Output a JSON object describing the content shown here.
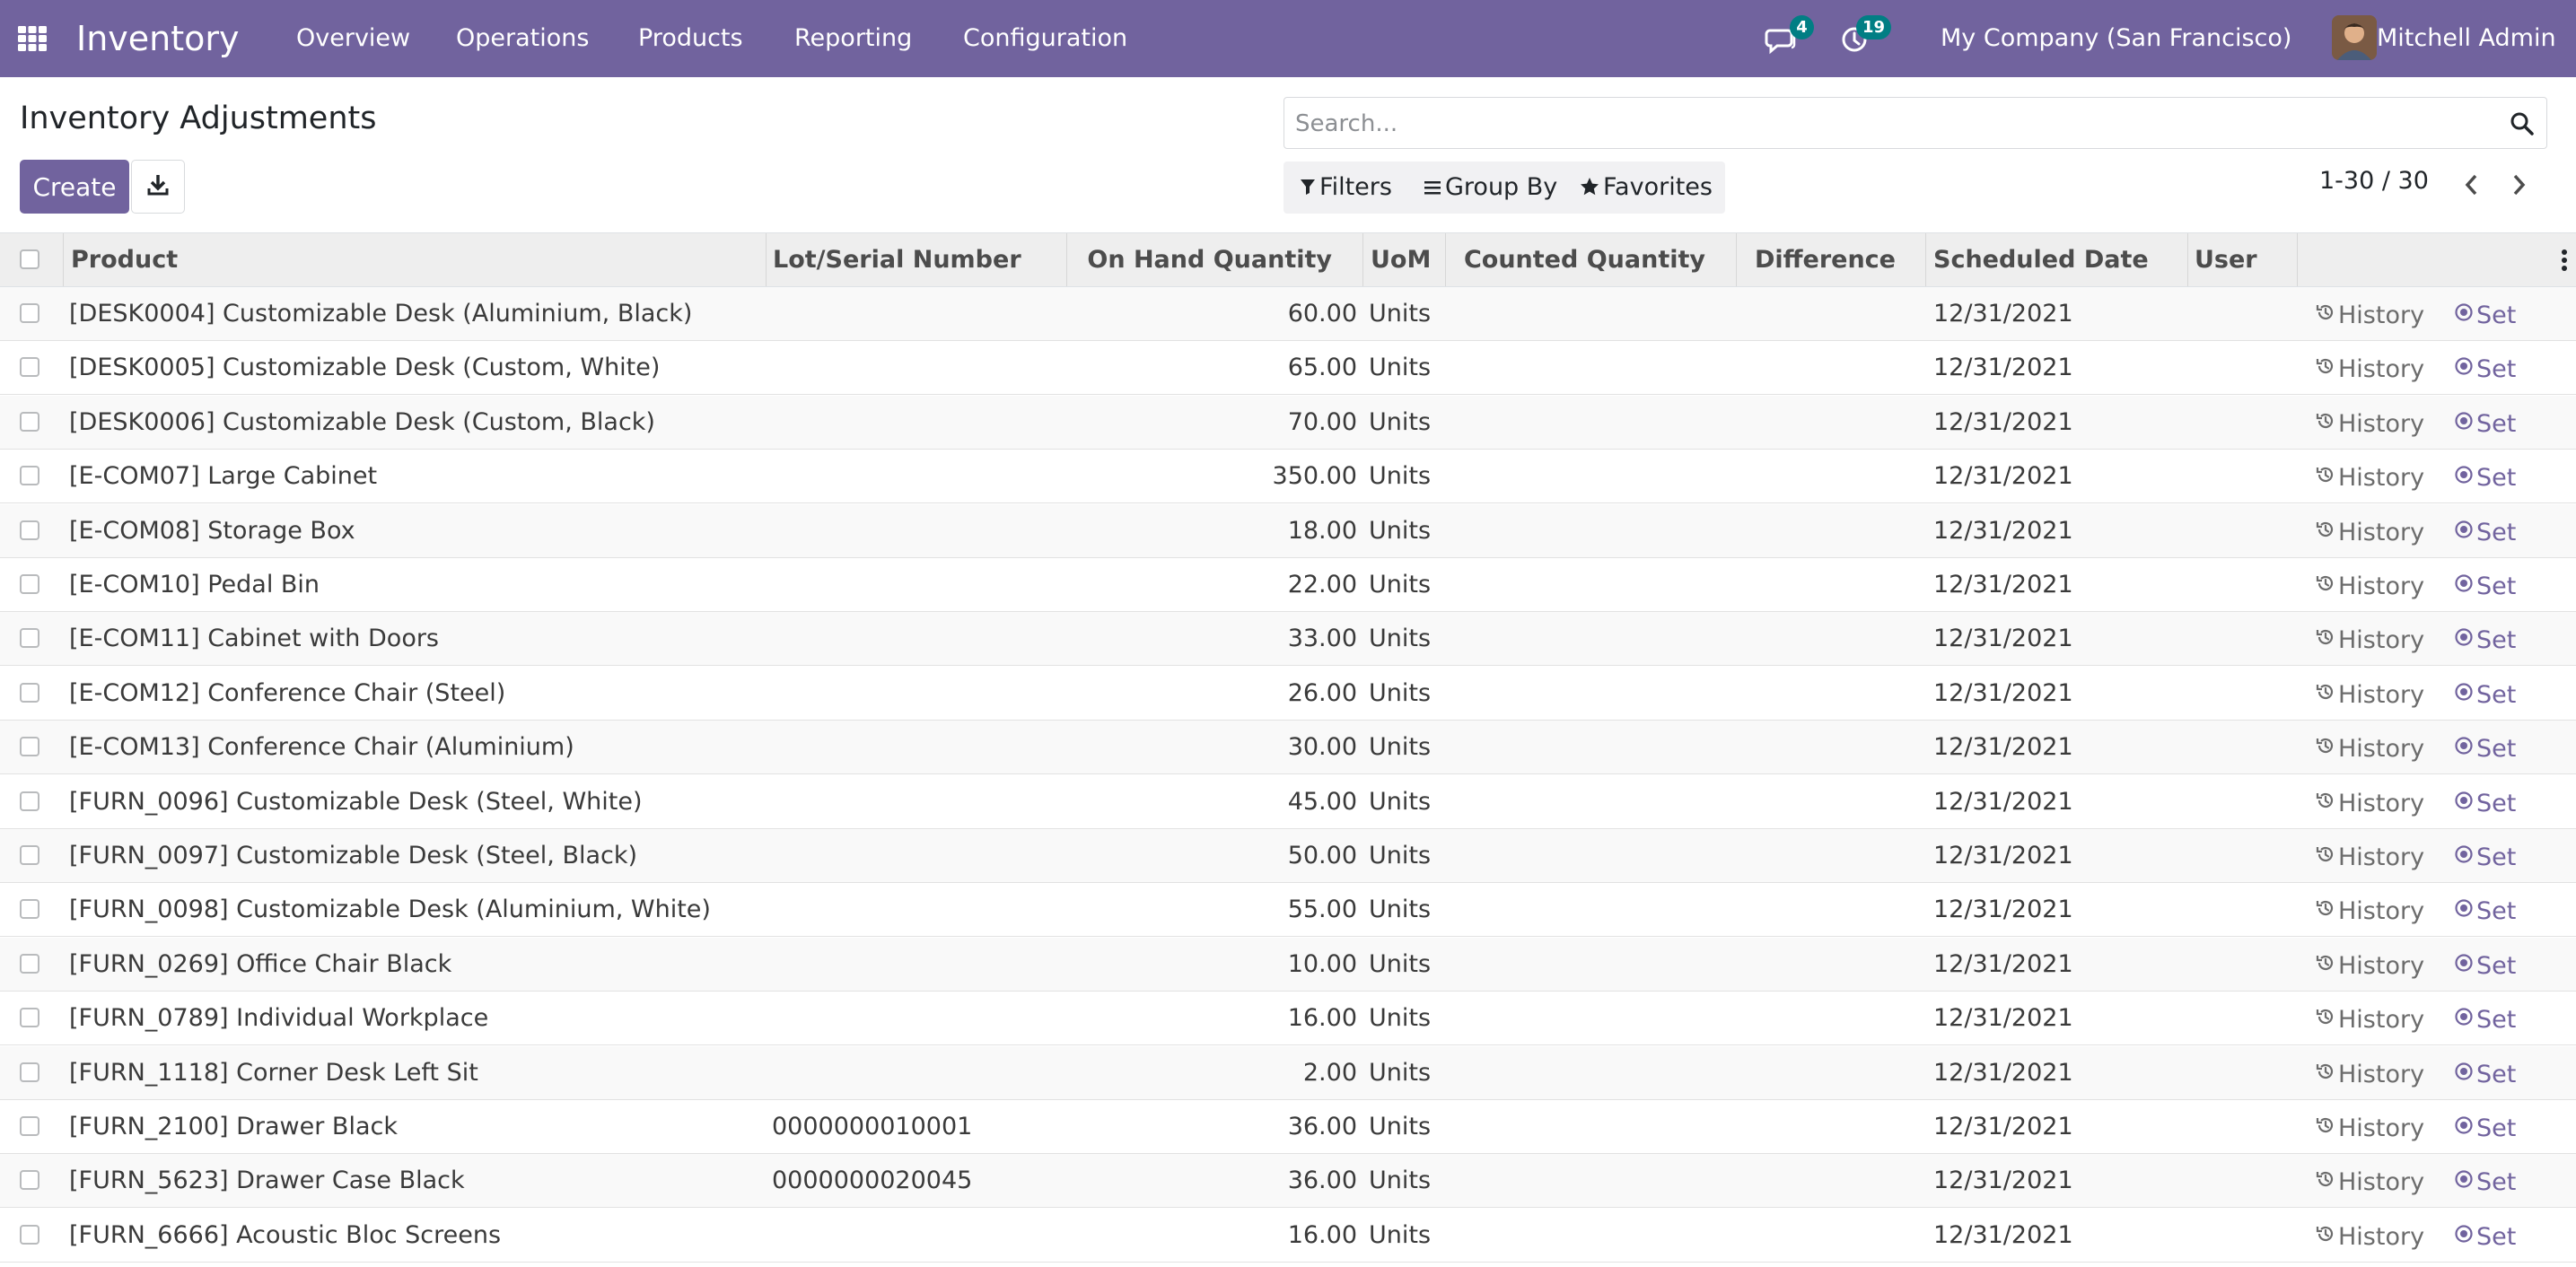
{
  "navbar": {
    "brand": "Inventory",
    "menu": [
      "Overview",
      "Operations",
      "Products",
      "Reporting",
      "Configuration"
    ],
    "messages_count": "4",
    "activities_count": "19",
    "company": "My Company (San Francisco)",
    "user": "Mitchell Admin",
    "icons": [
      "apps-grid-icon",
      "chat-icon",
      "clock-icon"
    ],
    "accent_color": "#71639e",
    "badge_color": "#017e84"
  },
  "control_panel": {
    "title": "Inventory Adjustments",
    "create_label": "Create",
    "search_placeholder": "Search...",
    "filters_label": "Filters",
    "group_by_label": "Group By",
    "favorites_label": "Favorites",
    "pager": "1-30 / 30"
  },
  "table": {
    "headers": {
      "product": "Product",
      "lot": "Lot/Serial Number",
      "on_hand": "On Hand Quantity",
      "uom": "UoM",
      "counted": "Counted Quantity",
      "difference": "Difference",
      "scheduled": "Scheduled Date",
      "user": "User"
    },
    "history_label": "History",
    "set_label": "Set",
    "rows": [
      {
        "product": "[DESK0004] Customizable Desk (Aluminium, Black)",
        "lot": "",
        "qty": "60.00",
        "uom": "Units",
        "date": "12/31/2021"
      },
      {
        "product": "[DESK0005] Customizable Desk (Custom, White)",
        "lot": "",
        "qty": "65.00",
        "uom": "Units",
        "date": "12/31/2021"
      },
      {
        "product": "[DESK0006] Customizable Desk (Custom, Black)",
        "lot": "",
        "qty": "70.00",
        "uom": "Units",
        "date": "12/31/2021"
      },
      {
        "product": "[E-COM07] Large Cabinet",
        "lot": "",
        "qty": "350.00",
        "uom": "Units",
        "date": "12/31/2021"
      },
      {
        "product": "[E-COM08] Storage Box",
        "lot": "",
        "qty": "18.00",
        "uom": "Units",
        "date": "12/31/2021"
      },
      {
        "product": "[E-COM10] Pedal Bin",
        "lot": "",
        "qty": "22.00",
        "uom": "Units",
        "date": "12/31/2021"
      },
      {
        "product": "[E-COM11] Cabinet with Doors",
        "lot": "",
        "qty": "33.00",
        "uom": "Units",
        "date": "12/31/2021"
      },
      {
        "product": "[E-COM12] Conference Chair (Steel)",
        "lot": "",
        "qty": "26.00",
        "uom": "Units",
        "date": "12/31/2021"
      },
      {
        "product": "[E-COM13] Conference Chair (Aluminium)",
        "lot": "",
        "qty": "30.00",
        "uom": "Units",
        "date": "12/31/2021"
      },
      {
        "product": "[FURN_0096] Customizable Desk (Steel, White)",
        "lot": "",
        "qty": "45.00",
        "uom": "Units",
        "date": "12/31/2021"
      },
      {
        "product": "[FURN_0097] Customizable Desk (Steel, Black)",
        "lot": "",
        "qty": "50.00",
        "uom": "Units",
        "date": "12/31/2021"
      },
      {
        "product": "[FURN_0098] Customizable Desk (Aluminium, White)",
        "lot": "",
        "qty": "55.00",
        "uom": "Units",
        "date": "12/31/2021"
      },
      {
        "product": "[FURN_0269] Office Chair Black",
        "lot": "",
        "qty": "10.00",
        "uom": "Units",
        "date": "12/31/2021"
      },
      {
        "product": "[FURN_0789] Individual Workplace",
        "lot": "",
        "qty": "16.00",
        "uom": "Units",
        "date": "12/31/2021"
      },
      {
        "product": "[FURN_1118] Corner Desk Left Sit",
        "lot": "",
        "qty": "2.00",
        "uom": "Units",
        "date": "12/31/2021"
      },
      {
        "product": "[FURN_2100] Drawer Black",
        "lot": "0000000010001",
        "qty": "36.00",
        "uom": "Units",
        "date": "12/31/2021"
      },
      {
        "product": "[FURN_5623] Drawer Case Black",
        "lot": "0000000020045",
        "qty": "36.00",
        "uom": "Units",
        "date": "12/31/2021"
      },
      {
        "product": "[FURN_6666] Acoustic Bloc Screens",
        "lot": "",
        "qty": "16.00",
        "uom": "Units",
        "date": "12/31/2021"
      }
    ]
  }
}
